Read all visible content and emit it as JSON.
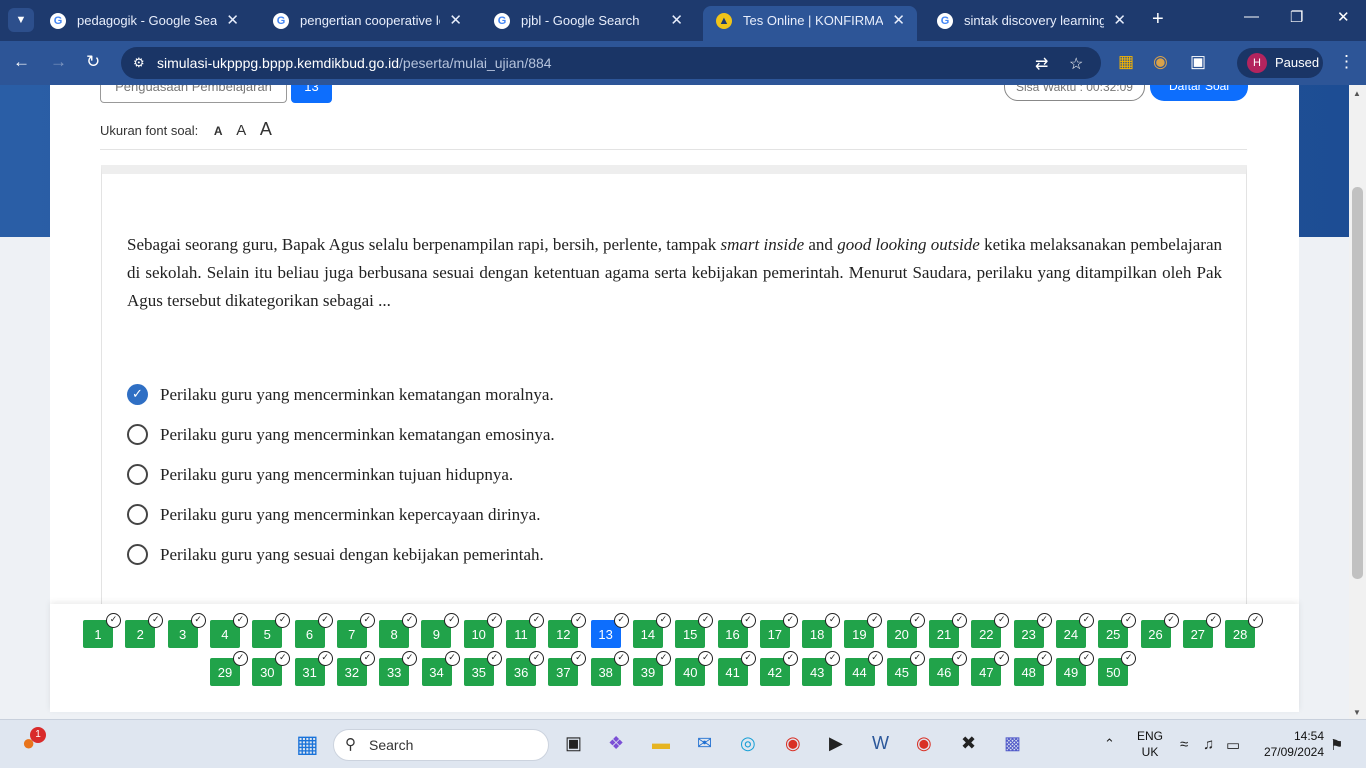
{
  "browser": {
    "tabs": [
      {
        "icon": "google-icon",
        "title": "pedagogik - Google Search",
        "active": false
      },
      {
        "icon": "google-icon",
        "title": "pengertian cooperative learn",
        "active": false
      },
      {
        "icon": "google-icon",
        "title": "pjbl - Google Search",
        "active": false
      },
      {
        "icon": "kemdikbud-icon",
        "title": "Tes Online | KONFIRMASI DA",
        "active": true
      },
      {
        "icon": "google-icon",
        "title": "sintak discovery learning - G",
        "active": false
      }
    ],
    "url_domain": "simulasi-ukpppg.bppp.kemdikbud.go.id",
    "url_path": "/peserta/mulai_ujian/884",
    "profile_initial": "H",
    "profile_status": "Paused"
  },
  "exam": {
    "category_label": "Penguasaan Pembelajaran",
    "question_number": "13",
    "timer_text": "Sisa Waktu : 00:32:09",
    "list_button": "Daftar Soal",
    "font_size_label": "Ukuran font soal:",
    "font_small": "A",
    "font_medium": "A",
    "font_large": "A",
    "question_pre": "Sebagai seorang guru, Bapak Agus selalu berpenampilan rapi, bersih, perlente, tampak ",
    "question_it1": "smart inside",
    "question_mid": " and ",
    "question_it2": "good looking outside",
    "question_post": " ketika melaksanakan pembelajaran di sekolah. Selain itu beliau juga berbusana sesuai dengan ketentuan agama serta kebijakan pemerintah. Menurut Saudara, perilaku yang ditampilkan oleh Pak Agus tersebut dikategorikan sebagai ...",
    "options": [
      {
        "text": "Perilaku guru yang mencerminkan kematangan moralnya.",
        "selected": true
      },
      {
        "text": "Perilaku guru yang mencerminkan kematangan emosinya.",
        "selected": false
      },
      {
        "text": " Perilaku guru yang mencerminkan tujuan hidupnya.",
        "selected": false
      },
      {
        "text": "Perilaku guru yang mencerminkan kepercayaan dirinya.",
        "selected": false
      },
      {
        "text": "Perilaku guru yang sesuai dengan kebijakan pemerintah.",
        "selected": false
      }
    ],
    "question_nav": {
      "total": 50,
      "current": 13,
      "answered_color": "#21a34a",
      "current_color": "#0d6efd"
    }
  },
  "taskbar": {
    "search_placeholder": "Search",
    "notification_count": "1",
    "language_line1": "ENG",
    "language_line2": "UK",
    "time": "14:54",
    "date": "27/09/2024"
  }
}
